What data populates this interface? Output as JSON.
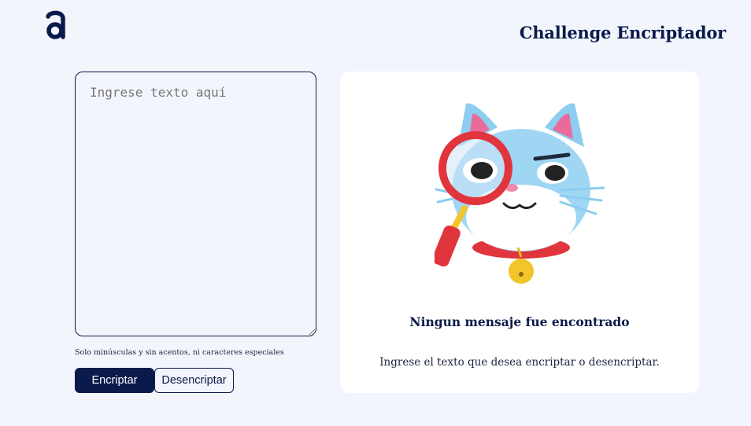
{
  "header": {
    "logo_icon": "alura-a-logo-icon",
    "title": "Challenge Encriptador"
  },
  "input": {
    "value": "",
    "placeholder": "Ingrese texto aquí"
  },
  "hint": "Solo minúsculas y sin acentos, ni caracteres especiales",
  "buttons": {
    "encrypt_label": "Encriptar",
    "decrypt_label": "Desencriptar"
  },
  "output": {
    "illustration": "cat-with-magnifying-glass",
    "empty_title": "Ningun mensaje fue encontrado",
    "empty_subtitle": "Ingrese el texto que desea encriptar o desencriptar."
  },
  "colors": {
    "background": "#f3f5fc",
    "primary": "#0a1a4a",
    "panel": "#ffffff"
  }
}
